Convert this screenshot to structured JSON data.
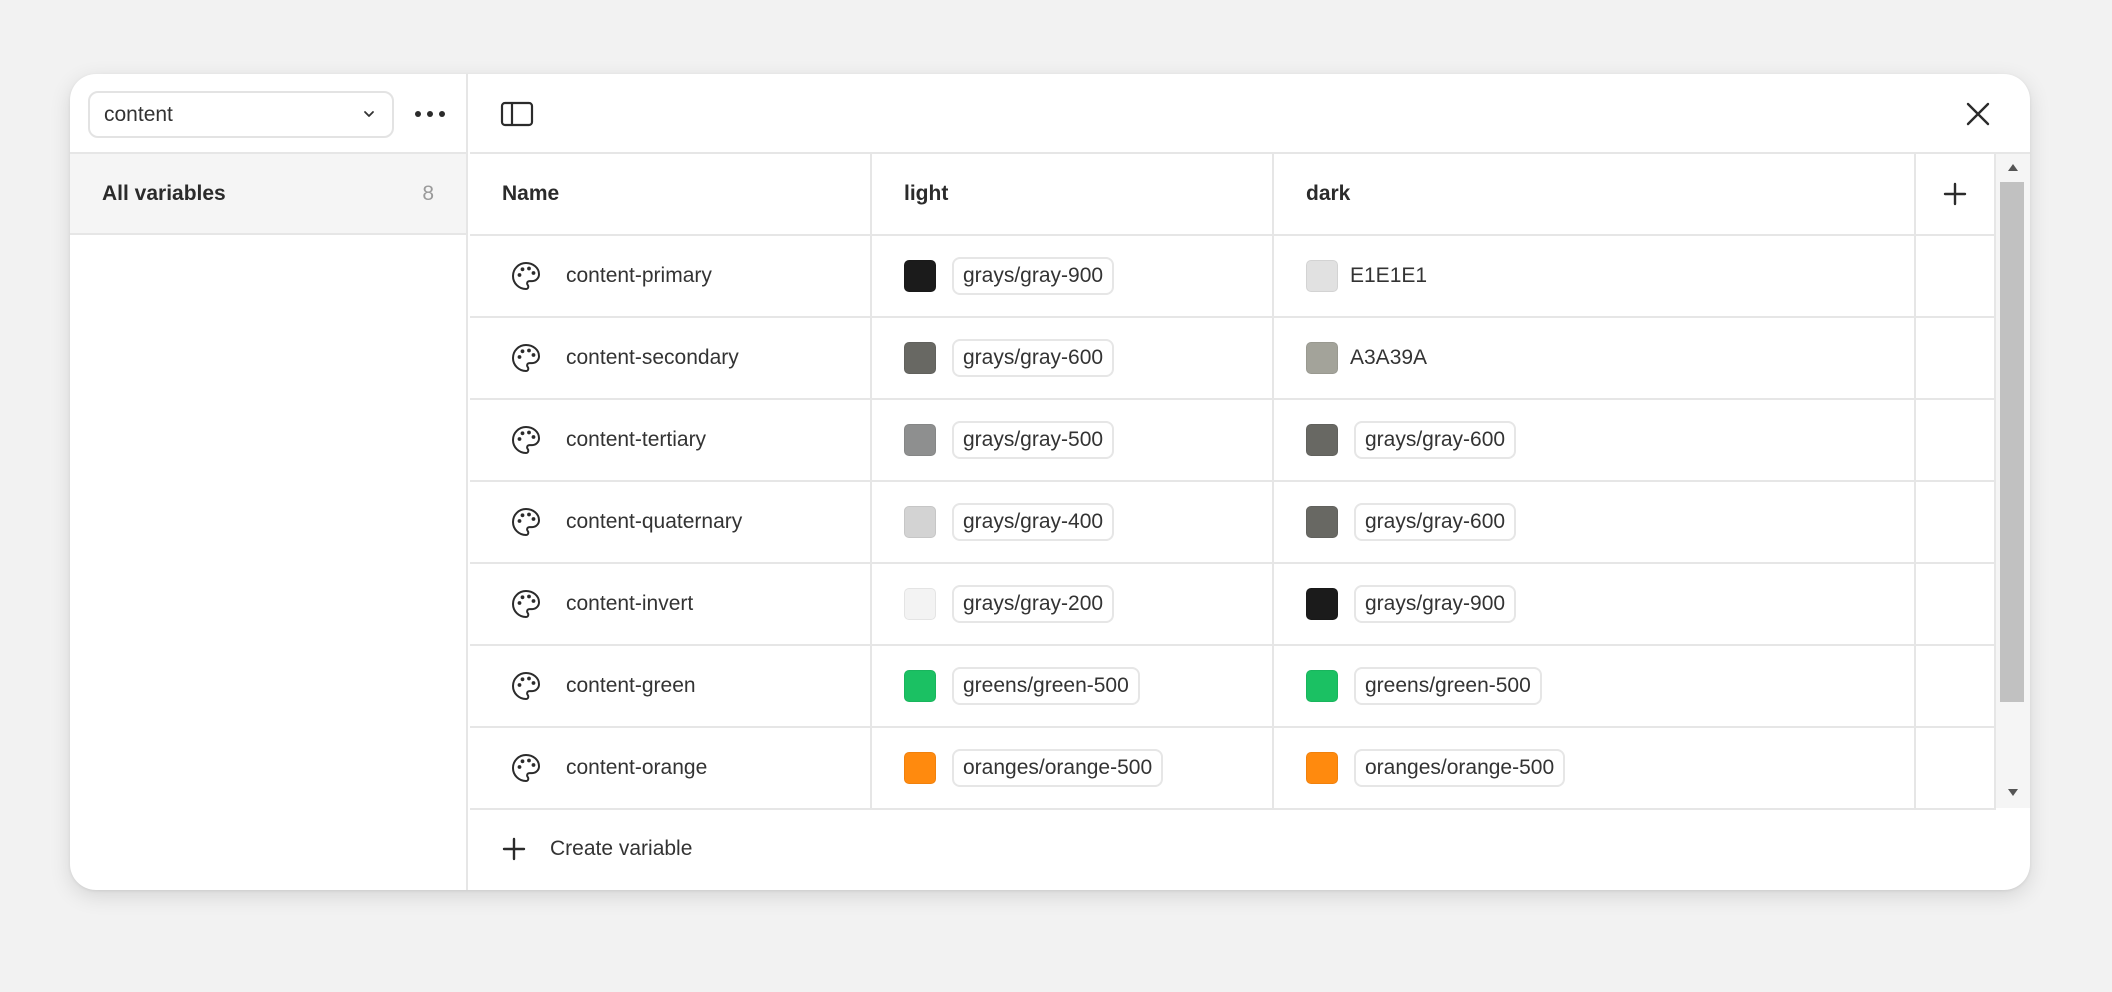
{
  "sidebar": {
    "collection_select": {
      "value": "content"
    },
    "all_variables": {
      "label": "All variables",
      "count": "8"
    }
  },
  "table": {
    "columns": {
      "name": "Name",
      "light": "light",
      "dark": "dark"
    },
    "rows": [
      {
        "name": "content-primary",
        "light": {
          "swatch": "#1b1b1b",
          "alias": "grays/gray-900"
        },
        "dark": {
          "swatch": "#e1e1e1",
          "hex": "E1E1E1"
        }
      },
      {
        "name": "content-secondary",
        "light": {
          "swatch": "#686863",
          "alias": "grays/gray-600"
        },
        "dark": {
          "swatch": "#a3a39a",
          "hex": "A3A39A"
        }
      },
      {
        "name": "content-tertiary",
        "light": {
          "swatch": "#8e8f8f",
          "alias": "grays/gray-500"
        },
        "dark": {
          "swatch": "#686863",
          "alias": "grays/gray-600"
        }
      },
      {
        "name": "content-quaternary",
        "light": {
          "swatch": "#d3d3d3",
          "alias": "grays/gray-400"
        },
        "dark": {
          "swatch": "#686863",
          "alias": "grays/gray-600"
        }
      },
      {
        "name": "content-invert",
        "light": {
          "swatch": "#f3f3f3",
          "alias": "grays/gray-200"
        },
        "dark": {
          "swatch": "#1b1b1b",
          "alias": "grays/gray-900"
        }
      },
      {
        "name": "content-green",
        "light": {
          "swatch": "#1bc163",
          "alias": "greens/green-500"
        },
        "dark": {
          "swatch": "#1bc163",
          "alias": "greens/green-500"
        }
      },
      {
        "name": "content-orange",
        "light": {
          "swatch": "#ff8a0e",
          "alias": "oranges/orange-500"
        },
        "dark": {
          "swatch": "#ff8a0e",
          "alias": "oranges/orange-500"
        }
      }
    ]
  },
  "footer": {
    "create_label": "Create variable"
  },
  "icons": {
    "more": "more-horizontal-icon",
    "chevron": "chevron-down-icon",
    "toggle": "sidebar-toggle-icon",
    "close": "close-icon",
    "add": "plus-icon",
    "variable": "palette-icon"
  }
}
